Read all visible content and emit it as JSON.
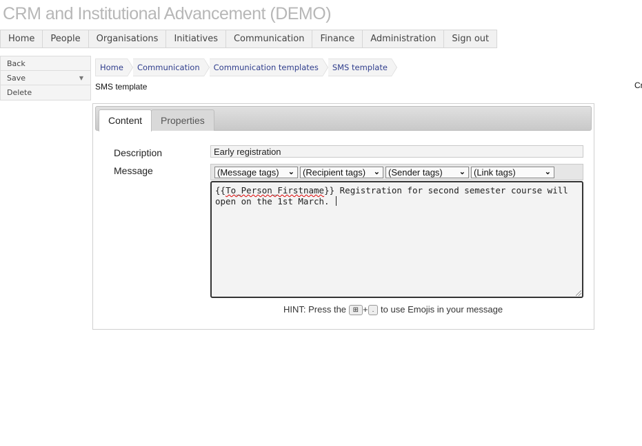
{
  "app": {
    "title": "CRM and Institutional Advancement (DEMO)"
  },
  "nav": [
    "Home",
    "People",
    "Organisations",
    "Initiatives",
    "Communication",
    "Finance",
    "Administration",
    "Sign out"
  ],
  "actions": {
    "back": "Back",
    "save": "Save",
    "delete": "Delete"
  },
  "breadcrumb": [
    "Home",
    "Communication",
    "Communication templates",
    "SMS template"
  ],
  "page": {
    "title": "SMS template",
    "cut_text": "Cr"
  },
  "tabs": {
    "content": "Content",
    "properties": "Properties",
    "active": "Content"
  },
  "form": {
    "description_label": "Description",
    "description_value": "Early registration",
    "message_label": "Message",
    "tag_selects": [
      "(Message tags)",
      "(Recipient tags)",
      "(Sender tags)",
      "(Link tags)"
    ],
    "message_token": "To_Person_Firstname",
    "message_rest": "}} Registration for second semester course will open on the 1st March. "
  },
  "hint": {
    "prefix": "HINT: Press the",
    "key1": "⊞",
    "plus": "+",
    "key2": ".",
    "suffix": "to use Emojis in your message"
  }
}
